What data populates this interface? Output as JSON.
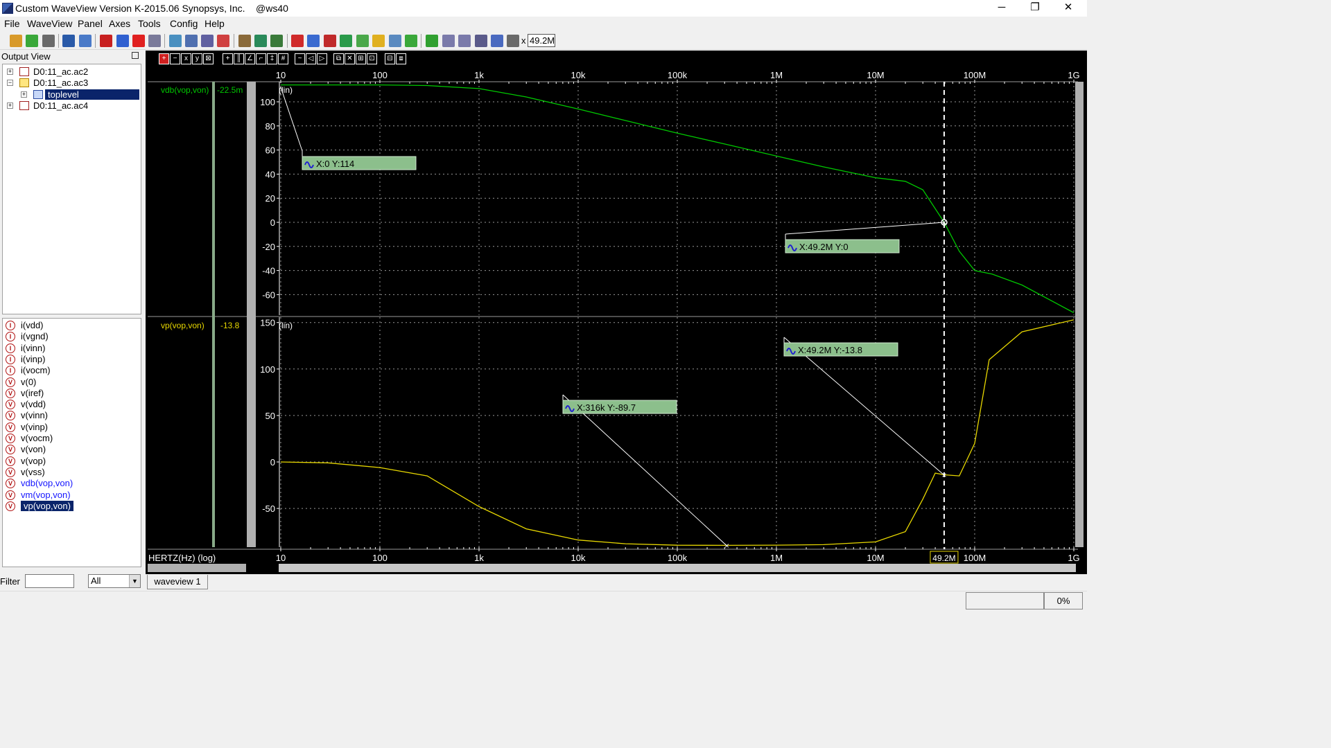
{
  "window": {
    "title": "Custom WaveView Version K-2015.06 Synopsys, Inc.    @ws40",
    "minimize": "─",
    "maximize": "❐",
    "close": "✕"
  },
  "menu": [
    "File",
    "WaveView",
    "Panel",
    "Axes",
    "Tools",
    "Config",
    "Help"
  ],
  "toolbar": {
    "x_label": "x",
    "x_value": "49.2M"
  },
  "output_view": {
    "title": "Output View",
    "tree": [
      {
        "label": "D0:11_ac.ac2",
        "expander": "+"
      },
      {
        "label": "D0:11_ac.ac3",
        "expander": "−"
      },
      {
        "label": "toplevel",
        "expander": "+",
        "selected": true
      },
      {
        "label": "D0:11_ac.ac4",
        "expander": "+"
      }
    ]
  },
  "signals": [
    {
      "label": "i(vdd)",
      "icon": "I"
    },
    {
      "label": "i(vgnd)",
      "icon": "I"
    },
    {
      "label": "i(vinn)",
      "icon": "I"
    },
    {
      "label": "i(vinp)",
      "icon": "I"
    },
    {
      "label": "i(vocm)",
      "icon": "I"
    },
    {
      "label": "v(0)",
      "icon": "V"
    },
    {
      "label": "v(iref)",
      "icon": "V"
    },
    {
      "label": "v(vdd)",
      "icon": "V"
    },
    {
      "label": "v(vinn)",
      "icon": "V"
    },
    {
      "label": "v(vinp)",
      "icon": "V"
    },
    {
      "label": "v(vocm)",
      "icon": "V"
    },
    {
      "label": "v(von)",
      "icon": "V"
    },
    {
      "label": "v(vop)",
      "icon": "V"
    },
    {
      "label": "v(vss)",
      "icon": "V"
    },
    {
      "label": "vdb(vop,von)",
      "icon": "V"
    },
    {
      "label": "vm(vop,von)",
      "icon": "V"
    },
    {
      "label": "vp(vop,von)",
      "icon": "V"
    }
  ],
  "filter": {
    "label": "Filter",
    "value": "",
    "option": "All"
  },
  "colors": {
    "vdb": "#00c800",
    "vp": "#e8d800",
    "marker_bg": "#8cbf8c",
    "grid": "#9a9a9a",
    "highlight_sig": "#1414ff"
  },
  "x_axis": {
    "label": "HERTZ(Hz) (log)",
    "ticks": [
      "10",
      "100",
      "1k",
      "10k",
      "100k",
      "1M",
      "10M",
      "100M",
      "1G"
    ],
    "cursor_value": "49.2M"
  },
  "panels": [
    {
      "signal": "vdb(vop,von)",
      "cursor_value": "-22.5m",
      "scale": "(lin)",
      "y_ticks": [
        "100",
        "80",
        "60",
        "40",
        "20",
        "0",
        "-20",
        "-40",
        "-60"
      ],
      "markers": [
        "X:0 Y:114",
        "X:49.2M Y:0"
      ]
    },
    {
      "signal": "vp(vop,von)",
      "cursor_value": "-13.8",
      "scale": "(lin)",
      "y_ticks": [
        "150",
        "100",
        "50",
        "0",
        "-50"
      ],
      "markers": [
        "X:49.2M Y:-13.8",
        "X:316k Y:-89.7"
      ]
    }
  ],
  "tabs": [
    "waveview 1"
  ],
  "status": {
    "progress": "0%"
  },
  "chart_data": {
    "type": "line",
    "x_scale": "log",
    "xlim": [
      10,
      1000000000
    ],
    "xlabel": "HERTZ(Hz) (log)",
    "series": [
      {
        "name": "vdb(vop,von)",
        "ylim": [
          -70,
          115
        ],
        "points": [
          [
            10,
            114
          ],
          [
            100,
            114
          ],
          [
            300,
            113.5
          ],
          [
            1000,
            111
          ],
          [
            3000,
            104
          ],
          [
            10000,
            94
          ],
          [
            30000,
            84.5
          ],
          [
            100000,
            74
          ],
          [
            300000,
            65
          ],
          [
            1000000,
            55
          ],
          [
            3000000,
            46
          ],
          [
            10000000,
            37
          ],
          [
            20000000,
            34
          ],
          [
            30000000,
            27
          ],
          [
            49200000,
            0
          ],
          [
            70000000,
            -24
          ],
          [
            100000000,
            -40
          ],
          [
            150000000,
            -43
          ],
          [
            300000000,
            -52
          ],
          [
            1000000000,
            -75
          ]
        ]
      },
      {
        "name": "vp(vop,von)",
        "ylim": [
          -90,
          155
        ],
        "points": [
          [
            10,
            0
          ],
          [
            30,
            -1
          ],
          [
            100,
            -6
          ],
          [
            300,
            -15
          ],
          [
            1000,
            -48
          ],
          [
            3000,
            -72
          ],
          [
            10000,
            -84
          ],
          [
            30000,
            -88
          ],
          [
            100000,
            -89.6
          ],
          [
            316000,
            -89.7
          ],
          [
            1000000,
            -89.5
          ],
          [
            3000000,
            -89
          ],
          [
            10000000,
            -86
          ],
          [
            20000000,
            -75
          ],
          [
            30000000,
            -40
          ],
          [
            40000000,
            -12
          ],
          [
            49200000,
            -13.8
          ],
          [
            70000000,
            -15
          ],
          [
            100000000,
            20
          ],
          [
            140000000,
            110
          ],
          [
            300000000,
            140
          ],
          [
            1000000000,
            153
          ]
        ]
      }
    ]
  }
}
